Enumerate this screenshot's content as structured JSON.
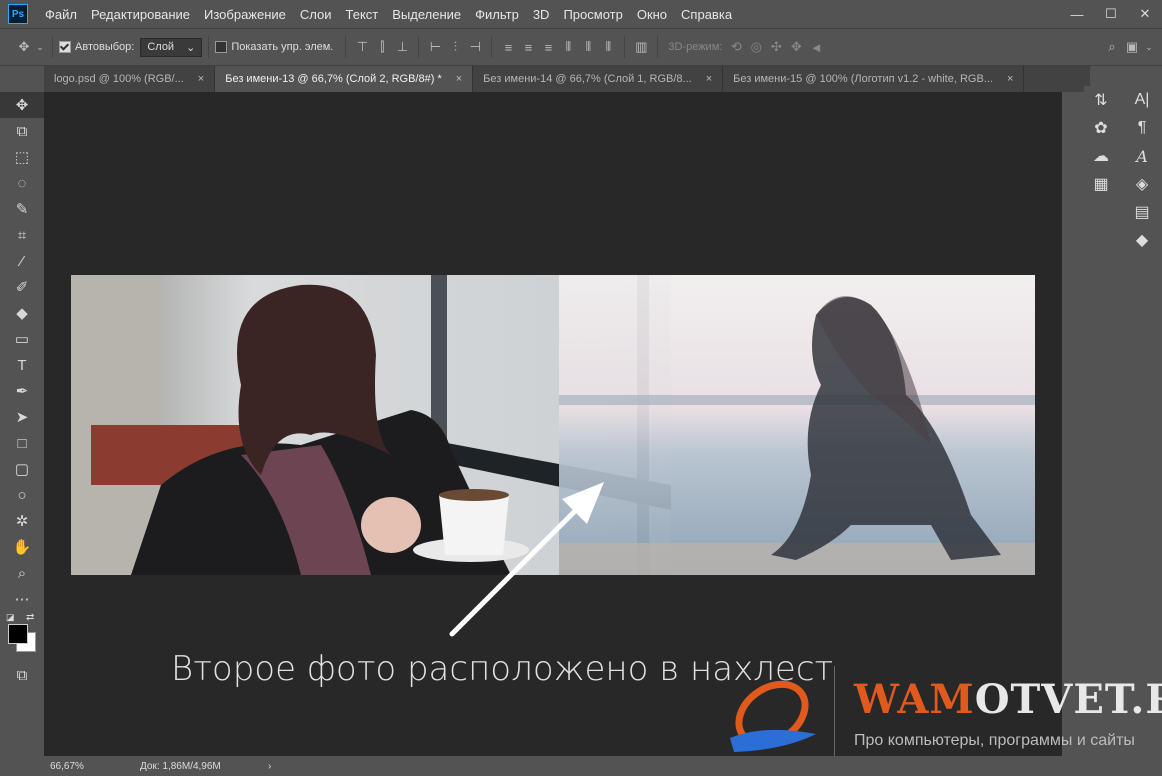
{
  "app": {
    "logo": "Ps"
  },
  "menu": [
    "Файл",
    "Редактирование",
    "Изображение",
    "Слои",
    "Текст",
    "Выделение",
    "Фильтр",
    "3D",
    "Просмотр",
    "Окно",
    "Справка"
  ],
  "window_controls": {
    "minimize": "—",
    "maximize": "☐",
    "close": "✕"
  },
  "options": {
    "auto_select_label": "Автовыбор:",
    "auto_select_value": "Слой",
    "show_transform_label": "Показать упр. элем.",
    "mode_3d_label": "3D-режим:"
  },
  "tabs": [
    {
      "label": "logo.psd @ 100% (RGB/...",
      "close": "×",
      "active": false
    },
    {
      "label": "Без имени-13 @ 66,7% (Слой 2, RGB/8#) *",
      "close": "×",
      "active": true
    },
    {
      "label": "Без имени-14 @ 66,7% (Слой 1, RGB/8...",
      "close": "×",
      "active": false
    },
    {
      "label": "Без имени-15 @ 100% (Логотип v1.2 - white, RGB...",
      "close": "×",
      "active": false
    }
  ],
  "annotation": "Второе фото расположено в  нахлест",
  "status": {
    "zoom": "66,67%",
    "doc": "Док: 1,86M/4,96M",
    "arrow": "›"
  },
  "watermark": {
    "title_highlight": "WAM",
    "title_rest": "OTVET.RU",
    "subtitle": "Про компьютеры, программы и сайты"
  },
  "colors": {
    "accent": "#e05a1e",
    "panel": "#535353",
    "canvas": "#282828"
  }
}
